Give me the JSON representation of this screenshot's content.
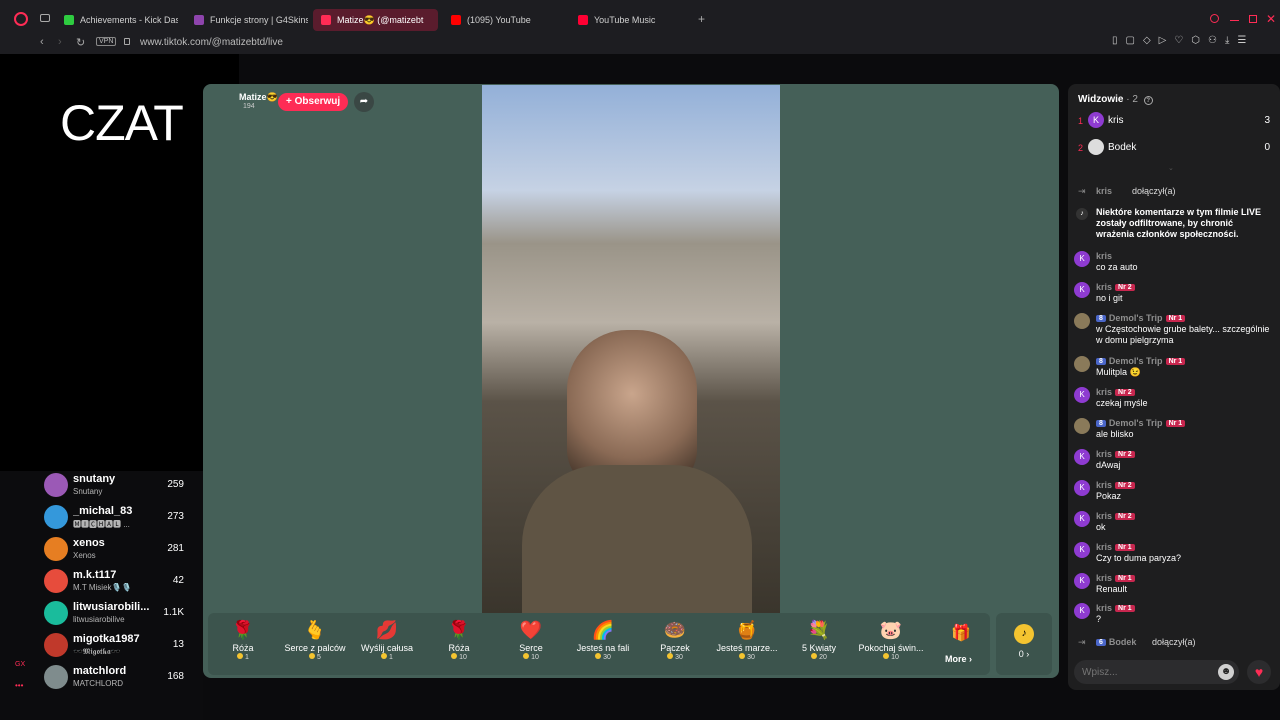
{
  "browser": {
    "tabs": [
      {
        "label": "Achievements - Kick Dash",
        "color": "#2ecc40"
      },
      {
        "label": "Funkcje strony | G4Skins",
        "color": "#8e44ad"
      },
      {
        "label": "Matize😎 (@matizebt",
        "color": "#fe2c55"
      },
      {
        "label": "(1095) YouTube",
        "color": "#ff0000"
      },
      {
        "label": "YouTube Music",
        "color": "#ff0033"
      }
    ],
    "url": "www.tiktok.com/@matizebtd/live",
    "vpn": "VPN",
    "new_tab": "+"
  },
  "overlay": {
    "czat": "CZAT"
  },
  "streamer": {
    "name": "Matize😎",
    "likes": "194",
    "follow_label": "+ Obserwuj"
  },
  "left_list": [
    {
      "name": "snutany",
      "sub": "Snutany",
      "count": "259",
      "color": "#9b59b6"
    },
    {
      "name": "_michal_83",
      "sub": "🅼🅸🅲🅷🅰🅻 ...",
      "count": "273",
      "color": "#3498db"
    },
    {
      "name": "xenos",
      "sub": "Xenos",
      "count": "281",
      "color": "#e67e22"
    },
    {
      "name": "m.k.t117",
      "sub": "M.T Misiek🎙️🎙️",
      "count": "42",
      "color": "#e74c3c"
    },
    {
      "name": "litwusiarobili...",
      "sub": "litwusiarobilive",
      "count": "1.1K",
      "color": "#1abc9c"
    },
    {
      "name": "migotka1987",
      "sub": "🕶️𝕸𝖎𝖌𝖔𝖙𝖐𝖆🕶️",
      "count": "13",
      "color": "#c0392b"
    },
    {
      "name": "matchlord",
      "sub": "MATCHLORD",
      "count": "168",
      "color": "#7f8c8d"
    }
  ],
  "gifts": [
    {
      "label": "Róża",
      "price": "1",
      "icon": "🌹"
    },
    {
      "label": "Serce z palców",
      "price": "5",
      "icon": "🫰"
    },
    {
      "label": "Wyślij całusa",
      "price": "1",
      "icon": "💋"
    },
    {
      "label": "Róża",
      "price": "10",
      "icon": "🌹"
    },
    {
      "label": "Serce",
      "price": "10",
      "icon": "❤️"
    },
    {
      "label": "Jesteś na fali",
      "price": "30",
      "icon": "🌈"
    },
    {
      "label": "Pączek",
      "price": "30",
      "icon": "🍩"
    },
    {
      "label": "Jesteś marze...",
      "price": "30",
      "icon": "🍯"
    },
    {
      "label": "5 Kwiaty",
      "price": "20",
      "icon": "💐"
    },
    {
      "label": "Pokochaj świn...",
      "price": "10",
      "icon": "🐷"
    }
  ],
  "gift_more": "More ›",
  "coin_balance": "0 ›",
  "viewers": {
    "title": "Widzowie",
    "count": "· 2",
    "list": [
      {
        "rank": "1",
        "name": "kris",
        "count": "3",
        "initial": "K",
        "color": "#8e3bd1"
      },
      {
        "rank": "2",
        "name": "Bodek",
        "count": "0",
        "initial": "",
        "color": "#dddddd"
      }
    ]
  },
  "chat": [
    {
      "user": "kris",
      "text": "dołączył(a)",
      "type": "join"
    },
    {
      "user": "",
      "text": "Niektóre komentarze w tym filmie LIVE zostały odfiltrowane, by chronić wrażenia członków społeczności.",
      "type": "system"
    },
    {
      "user": "kris",
      "text": "co za auto",
      "badge": ""
    },
    {
      "user": "kris",
      "text": "no i git",
      "badge": "Nr 2"
    },
    {
      "user": "Demol's Trip",
      "text": "w Częstochowie grube balety... szczególnie w domu pielgrzyma",
      "badge": "Nr 1",
      "level": "8"
    },
    {
      "user": "Demol's Trip",
      "text": "Mulitpla 😉",
      "badge": "Nr 1",
      "level": "8"
    },
    {
      "user": "kris",
      "text": "czekaj myśle",
      "badge": "Nr 2"
    },
    {
      "user": "Demol's Trip",
      "text": "ale blisko",
      "badge": "Nr 1",
      "level": "8"
    },
    {
      "user": "kris",
      "text": "dAwaj",
      "badge": "Nr 2"
    },
    {
      "user": "kris",
      "text": "Pokaz",
      "badge": "Nr 2"
    },
    {
      "user": "kris",
      "text": "ok",
      "badge": "Nr 2"
    },
    {
      "user": "kris",
      "text": "Czy to duma paryza?",
      "badge": "Nr 1"
    },
    {
      "user": "kris",
      "text": "Renault",
      "badge": "Nr 1"
    },
    {
      "user": "kris",
      "text": "?",
      "badge": "Nr 1"
    },
    {
      "user": "Bodek",
      "text": "dołączył(a)",
      "type": "join",
      "level": "6"
    }
  ],
  "input_placeholder": "Wpisz..."
}
